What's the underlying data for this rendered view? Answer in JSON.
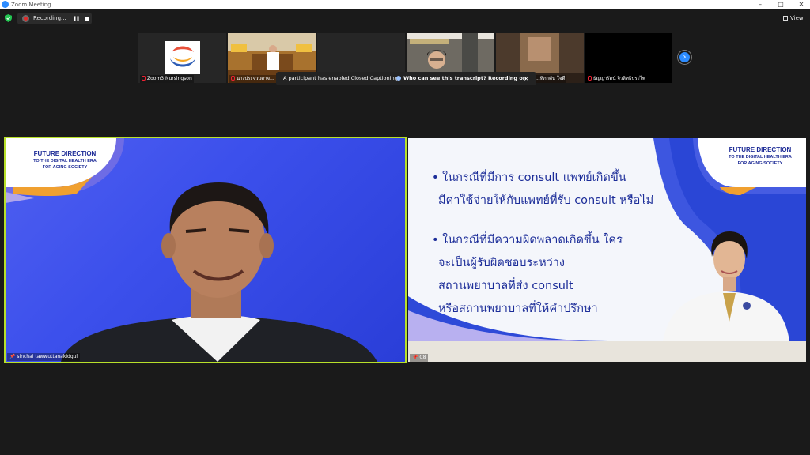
{
  "window": {
    "title": "Zoom Meeting",
    "minimize": "–",
    "maximize": "□",
    "close": "✕"
  },
  "toolbar": {
    "recording_label": "Recording...",
    "pause_glyph": "❚❚",
    "view_label": "View"
  },
  "thumbnails": [
    {
      "name": "Zoom3 Nursingson"
    },
    {
      "name": "นางประจวบศาจ..."
    },
    {
      "name": ""
    },
    {
      "name": ""
    },
    {
      "name": "...ทิภาคัน ใจดี"
    },
    {
      "name": "ธัญญารัตน์ จิวสิทธิประไพ"
    }
  ],
  "cc_banner": {
    "message": "A participant has enabled Closed Captioning",
    "link": "Who can see this transcript? Recording on",
    "close": "×"
  },
  "next_glyph": "›",
  "speaker": {
    "name": "sinchai tawwuttanakidgul"
  },
  "badge": {
    "line1": "FUTURE DIRECTION",
    "line2": "TO THE DIGITAL HEALTH ERA",
    "line3": "FOR AGING SOCIETY"
  },
  "slide": {
    "name": "C8",
    "bullets": [
      [
        "• ในกรณีที่มีการ consult แพทย์เกิดขึ้น",
        "มีค่าใช้จ่ายให้กับแพทย์ที่รับ consult หรือไม่"
      ],
      [
        "• ในกรณีที่มีความผิดพลาดเกิดขึ้น ใคร",
        "จะเป็นผู้รับผิดชอบระหว่าง",
        "สถานพยาบาลที่ส่ง consult",
        "หรือสถานพยาบาลที่ให้คำปรึกษา"
      ]
    ]
  },
  "colors": {
    "accent": "#2d8cff",
    "speaker_border": "#b8e02a",
    "slide_text": "#1c2d99"
  }
}
